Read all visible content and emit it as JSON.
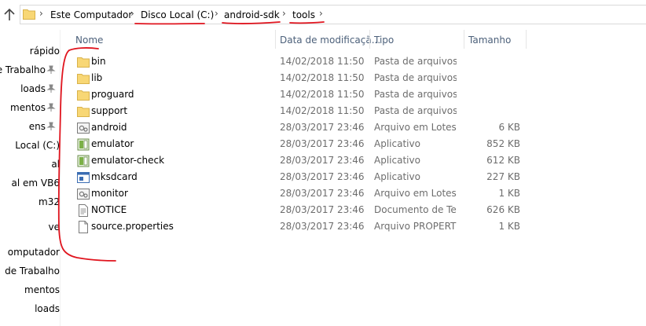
{
  "address_bar": {
    "crumbs": [
      "Este Computador",
      "Disco Local (C:)",
      "android-sdk",
      "tools"
    ]
  },
  "nav": {
    "items": [
      {
        "label": "rápido",
        "pinned": false
      },
      {
        "label": "de Trabalho",
        "pinned": true
      },
      {
        "label": "loads",
        "pinned": true
      },
      {
        "label": "mentos",
        "pinned": true
      },
      {
        "label": "ens",
        "pinned": true
      },
      {
        "label": "Local (C:)",
        "pinned": false
      },
      {
        "label": "al",
        "pinned": false
      },
      {
        "label": "al em VB6",
        "pinned": false
      },
      {
        "label": "m32",
        "pinned": false
      },
      {
        "label": "ve",
        "pinned": false
      },
      {
        "label": "omputador",
        "pinned": false
      },
      {
        "label": "de Trabalho",
        "pinned": false
      },
      {
        "label": "mentos",
        "pinned": false
      },
      {
        "label": "loads",
        "pinned": false
      }
    ]
  },
  "columns": {
    "name": "Nome",
    "date": "Data de modificaçã...",
    "type": "Tipo",
    "size": "Tamanho"
  },
  "files": [
    {
      "name": "bin",
      "date": "14/02/2018 11:50",
      "type": "Pasta de arquivos",
      "size": "",
      "icon": "folder-icon"
    },
    {
      "name": "lib",
      "date": "14/02/2018 11:50",
      "type": "Pasta de arquivos",
      "size": "",
      "icon": "folder-icon"
    },
    {
      "name": "proguard",
      "date": "14/02/2018 11:50",
      "type": "Pasta de arquivos",
      "size": "",
      "icon": "folder-icon"
    },
    {
      "name": "support",
      "date": "14/02/2018 11:50",
      "type": "Pasta de arquivos",
      "size": "",
      "icon": "folder-icon"
    },
    {
      "name": "android",
      "date": "28/03/2017 23:46",
      "type": "Arquivo em Lotes ...",
      "size": "6 KB",
      "icon": "batch-file-icon"
    },
    {
      "name": "emulator",
      "date": "28/03/2017 23:46",
      "type": "Aplicativo",
      "size": "852 KB",
      "icon": "application-icon"
    },
    {
      "name": "emulator-check",
      "date": "28/03/2017 23:46",
      "type": "Aplicativo",
      "size": "612 KB",
      "icon": "application-icon"
    },
    {
      "name": "mksdcard",
      "date": "28/03/2017 23:46",
      "type": "Aplicativo",
      "size": "227 KB",
      "icon": "window-app-icon"
    },
    {
      "name": "monitor",
      "date": "28/03/2017 23:46",
      "type": "Arquivo em Lotes ...",
      "size": "1 KB",
      "icon": "batch-file-icon"
    },
    {
      "name": "NOTICE",
      "date": "28/03/2017 23:46",
      "type": "Documento de Te...",
      "size": "626 KB",
      "icon": "text-document-icon"
    },
    {
      "name": "source.properties",
      "date": "28/03/2017 23:46",
      "type": "Arquivo PROPERTI...",
      "size": "1 KB",
      "icon": "blank-file-icon"
    }
  ],
  "colors": {
    "folder": "#f8d775",
    "header_text": "#4c607a",
    "annotation": "#e0141e"
  }
}
